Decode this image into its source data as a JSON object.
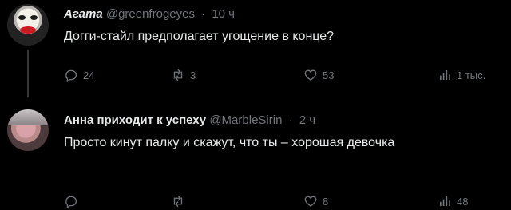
{
  "tweets": [
    {
      "name": "Агата",
      "handle": "@greenfrogeyes",
      "time": "10 ч",
      "text": "Догги-стайл предполагает угощение в конце?",
      "replies": "24",
      "retweets": "3",
      "likes": "53",
      "views": "1 тыс."
    },
    {
      "name": "Анна приходит к успеху",
      "handle": "@MarbleSirin",
      "time": "2 ч",
      "text": "Просто кинут палку и скажут, что ты – хорошая девочка",
      "replies": "",
      "retweets": "",
      "likes": "8",
      "views": "48"
    }
  ],
  "separator": "·",
  "icons": {
    "reply": "reply-icon",
    "retweet": "retweet-icon",
    "like": "heart-icon",
    "views": "views-icon"
  }
}
